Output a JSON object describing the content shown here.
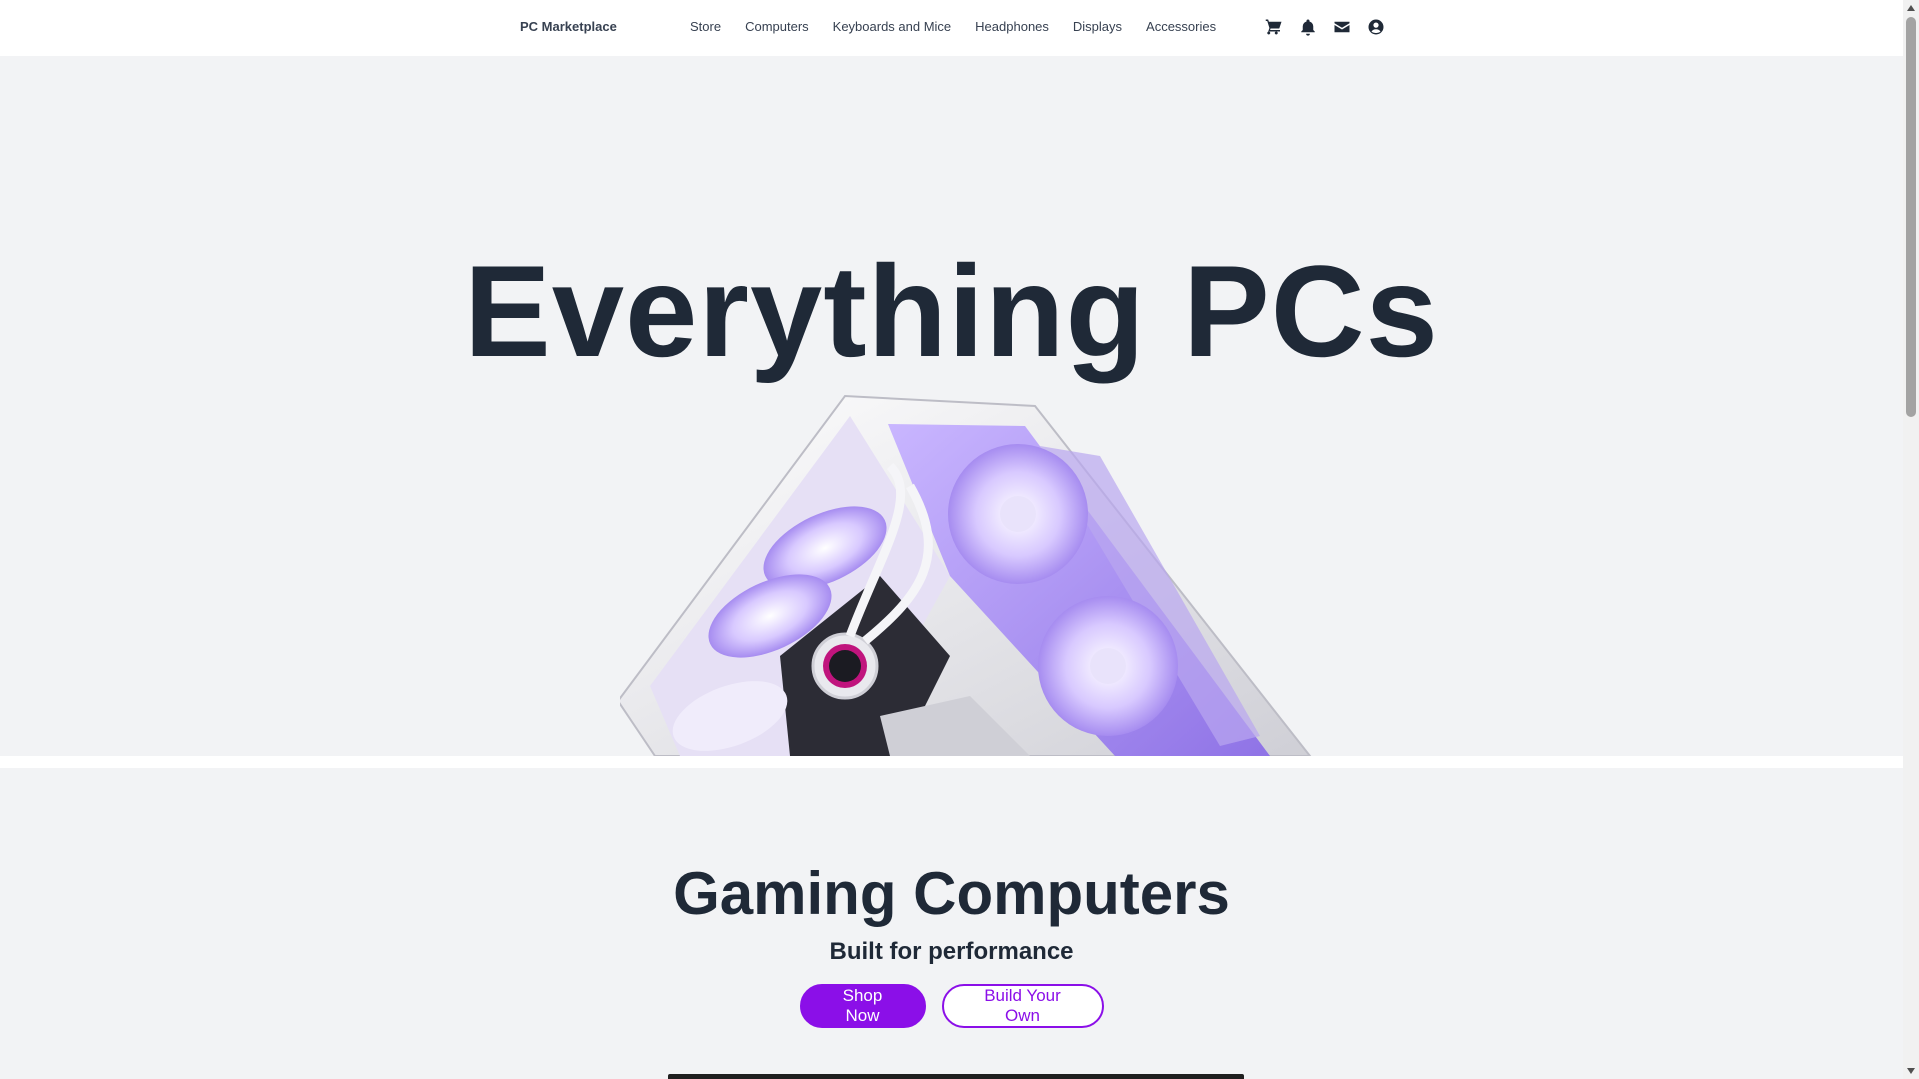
{
  "nav": {
    "brand": "PC Marketplace",
    "links": [
      "Store",
      "Computers",
      "Keyboards and Mice",
      "Headphones",
      "Displays",
      "Accessories"
    ],
    "icons": [
      "cart-icon",
      "bell-icon",
      "envelope-icon",
      "user-circle-icon"
    ]
  },
  "hero": {
    "title": "Everything PCs",
    "image": "white-pc-case-with-purple-fans"
  },
  "gaming": {
    "title": "Gaming Computers",
    "subtitle": "Built for performance",
    "primary_button": "Shop Now",
    "secondary_button": "Build Your Own"
  },
  "colors": {
    "accent": "#8b0fe8",
    "text": "#1f2937",
    "hero_bg": "#f2f3f5"
  }
}
